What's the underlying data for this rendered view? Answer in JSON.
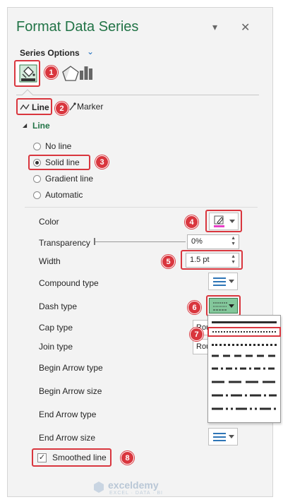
{
  "panel": {
    "title": "Format Data Series",
    "pin_glyph": "▾",
    "close_glyph": "✕",
    "series_options_label": "Series Options",
    "series_options_chevron": "⌄"
  },
  "tabs": [
    {
      "name": "fill-line-tab",
      "icon": "paint-bucket-icon",
      "selected": true
    },
    {
      "name": "effects-tab",
      "icon": "pentagon-icon"
    },
    {
      "name": "series-options-tab",
      "icon": "bar-chart-icon"
    }
  ],
  "subtabs": {
    "line_label": "Line",
    "marker_label": "Marker"
  },
  "line_section": {
    "header": "Line",
    "radios": [
      {
        "label": "No line",
        "selected": false
      },
      {
        "label": "Solid line",
        "selected": true
      },
      {
        "label": "Gradient line",
        "selected": false
      },
      {
        "label": "Automatic",
        "selected": false
      }
    ]
  },
  "properties": {
    "color_label": "Color",
    "transparency_label": "Transparency",
    "transparency_value": "0%",
    "width_label": "Width",
    "width_value": "1.5 pt",
    "compound_label": "Compound type",
    "dash_label": "Dash type",
    "cap_label": "Cap type",
    "cap_value": "Rou",
    "join_label": "Join type",
    "join_value": "Rou",
    "begin_arrow_type_label": "Begin Arrow type",
    "begin_arrow_size_label": "Begin Arrow size",
    "end_arrow_type_label": "End Arrow type",
    "end_arrow_size_label": "End Arrow size",
    "smoothed_label": "Smoothed line",
    "smoothed_checked": true,
    "check_glyph": "✓"
  },
  "colors": {
    "accent_green": "#217346",
    "callout_red": "#d9363e",
    "line_color_swatch": "#e83fc8",
    "dash_selected_bg": "#83c79b"
  },
  "callouts": [
    "1",
    "2",
    "3",
    "4",
    "5",
    "6",
    "7",
    "8"
  ],
  "watermark": {
    "brand": "exceldemy",
    "tagline": "EXCEL · DATA · BI"
  }
}
